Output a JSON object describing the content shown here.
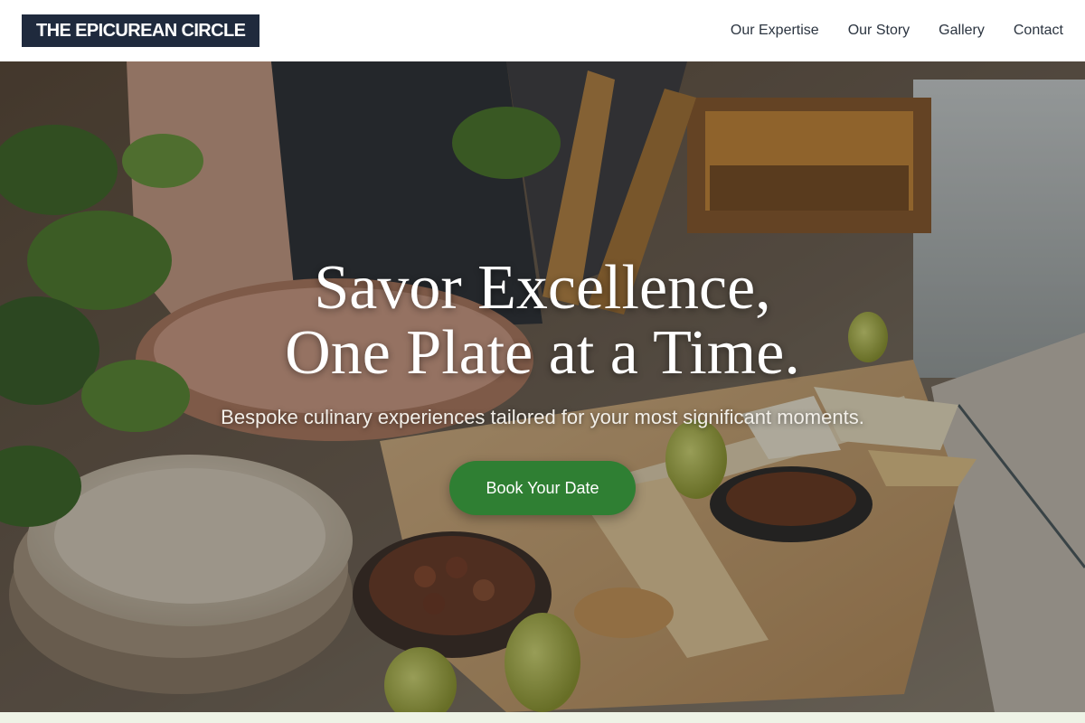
{
  "header": {
    "brand": "THE EPICUREAN CIRCLE",
    "nav": [
      {
        "label": "Our Expertise"
      },
      {
        "label": "Our Story"
      },
      {
        "label": "Gallery"
      },
      {
        "label": "Contact"
      }
    ]
  },
  "hero": {
    "title_line1": "Savor Excellence,",
    "title_line2": "One Plate at a Time.",
    "subtitle": "Bespoke culinary experiences tailored for your most significant moments.",
    "cta_label": "Book Your Date"
  },
  "colors": {
    "brand_bg": "#1f2a3d",
    "cta_green": "#2f7f33",
    "page_bg": "#eef3e6"
  }
}
